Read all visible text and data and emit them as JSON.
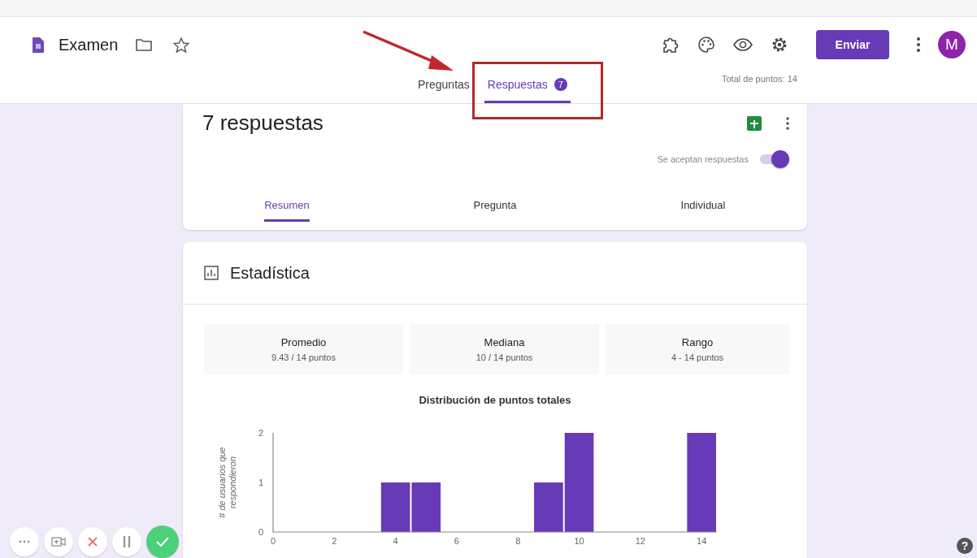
{
  "header": {
    "title": "Examen",
    "send_button": "Enviar",
    "avatar": "M",
    "total_points": "Total de puntos: 14",
    "tabs": [
      {
        "label": "Preguntas",
        "selected": false
      },
      {
        "label": "Respuestas",
        "selected": true,
        "badge": "7"
      }
    ]
  },
  "responses_card": {
    "title": "7 respuestas",
    "accepting": {
      "label": "Se aceptan respuestas",
      "on": true
    },
    "tabs": [
      {
        "label": "Resumen",
        "selected": true
      },
      {
        "label": "Pregunta",
        "selected": false
      },
      {
        "label": "Individual",
        "selected": false
      }
    ]
  },
  "stats_card": {
    "title": "Estadística",
    "stats": [
      {
        "label": "Promedio",
        "value": "9.43 / 14 puntos"
      },
      {
        "label": "Mediana",
        "value": "10 / 14 puntos"
      },
      {
        "label": "Rango",
        "value": "4 - 14 puntos"
      }
    ],
    "chart_data": {
      "type": "bar",
      "title": "Distribución de puntos totales",
      "ylabel": "# de usuarios que respondieron",
      "x": [
        4,
        5,
        9,
        10,
        14
      ],
      "series": [
        {
          "color": "#673ab7",
          "values": [
            1,
            1,
            1,
            2,
            2
          ]
        }
      ],
      "xlim": [
        0,
        14.5
      ],
      "ylim": [
        0,
        2
      ],
      "xticks": [
        0,
        2,
        4,
        6,
        8,
        10,
        12,
        14
      ],
      "yticks": [
        0,
        1,
        2
      ]
    }
  },
  "help_button": "?"
}
